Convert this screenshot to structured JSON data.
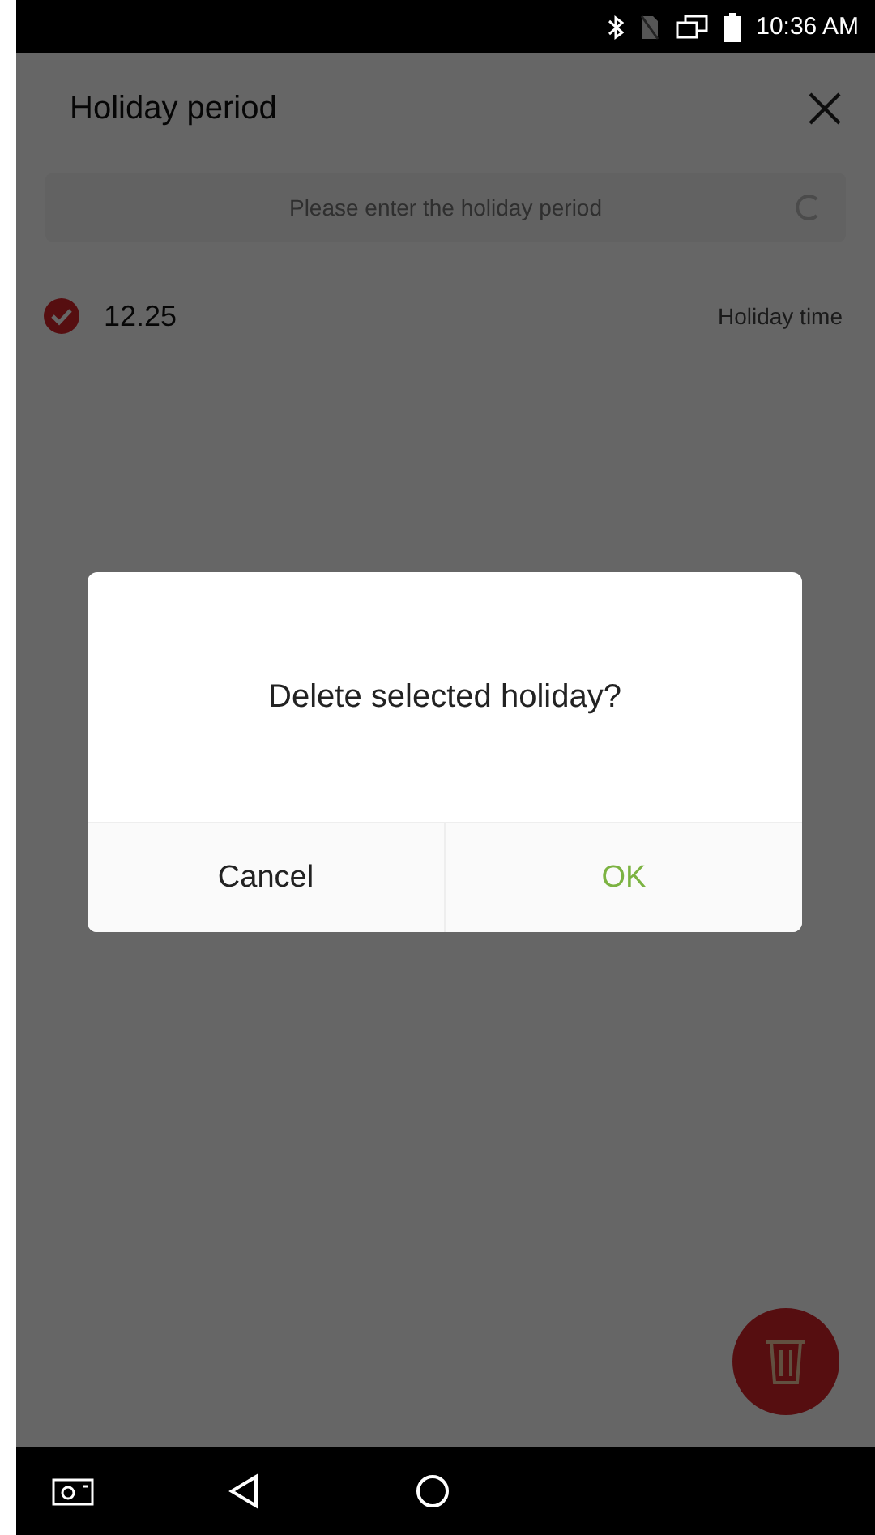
{
  "status_bar": {
    "time": "10:36 AM"
  },
  "header": {
    "title": "Holiday period"
  },
  "search": {
    "placeholder": "Please enter the holiday period"
  },
  "holidays": [
    {
      "date": "12.25",
      "label": "Holiday time",
      "checked": true
    }
  ],
  "dialog": {
    "message": "Delete selected holiday?",
    "buttons": [
      {
        "label": "Cancel",
        "kind": "cancel"
      },
      {
        "label": "OK",
        "kind": "confirm"
      }
    ]
  }
}
